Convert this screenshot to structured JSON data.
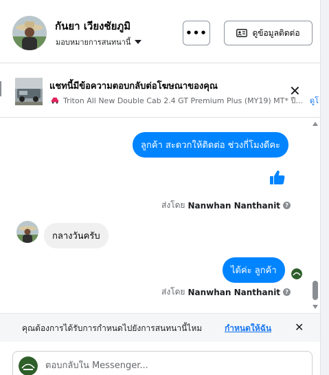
{
  "header": {
    "contact_name": "กันยา เวียงชัยภูมิ",
    "assign_label": "มอบหมายการสนทนานี้",
    "more_label": "•••",
    "contact_info_label": "ดูข้อมูลติดต่อ"
  },
  "ad_reply": {
    "title": "แชทนี้มีข้อความตอบกลับต่อโฆษณาของคุณ",
    "subtitle": "Triton All New Double Cab 2.4 GT Premium Plus (MY19) MT* ปี...",
    "link": "ดูโ"
  },
  "messages": [
    {
      "direction": "out",
      "text": "ลูกค้า สะดวกให้ติดต่อ ช่วงกี่โมงดีคะ"
    },
    {
      "direction": "out",
      "type": "like",
      "icon": "thumbs-up-icon"
    },
    {
      "type": "sentby",
      "prefix": "ส่งโดย",
      "agent": "Nanwhan Nanthanit"
    },
    {
      "direction": "in",
      "text": "กลางวันครับ"
    },
    {
      "direction": "out",
      "text": "ได้ค่ะ ลูกค้า"
    },
    {
      "type": "sentby",
      "prefix": "ส่งโดย",
      "agent": "Nanwhan Nanthanit"
    }
  ],
  "notice": {
    "text": "คุณต้องการได้รับการกำหนดไปยังการสนทนานี้ไหม",
    "link": "กำหนดให้ฉัน"
  },
  "composer": {
    "placeholder": "ตอบกลับใน Messenger..."
  },
  "colors": {
    "brand_blue": "#0084ff",
    "link_blue": "#1877f2",
    "incoming_bubble": "#f0f0f0"
  }
}
